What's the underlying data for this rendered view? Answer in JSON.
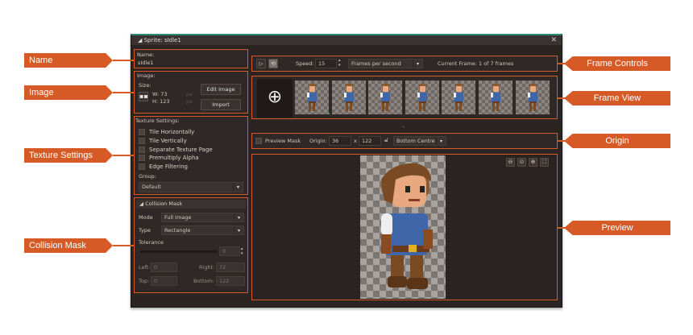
{
  "window": {
    "title": "Sprite: sIdle1"
  },
  "annotations": {
    "name": "Name",
    "image": "Image",
    "texture": "Texture Settings",
    "collision": "Collision Mask",
    "frame_controls": "Frame Controls",
    "frame_view": "Frame View",
    "origin": "Origin",
    "preview": "Preview"
  },
  "name_section": {
    "label": "Name:",
    "value": "sIdle1"
  },
  "image_section": {
    "label": "Image:",
    "size_label": "Size:",
    "width": "W: 73",
    "height": "H: 123",
    "unit": "px",
    "edit_button": "Edit Image",
    "import_button": "Import"
  },
  "texture": {
    "label": "Texture Settings:",
    "options": [
      "Tile Horizontally",
      "Tile Vertically",
      "Separate Texture Page",
      "Premultiply Alpha",
      "Edge Filtering"
    ],
    "group_label": "Group:",
    "group_value": "Default"
  },
  "collision": {
    "header": "Collision Mask",
    "mode_label": "Mode",
    "mode_value": "Full Image",
    "type_label": "Type",
    "type_value": "Rectangle",
    "tolerance_label": "Tolerance",
    "tolerance_value": "0",
    "left_label": "Left:",
    "left_value": "0",
    "right_label": "Right:",
    "right_value": "72",
    "top_label": "Top:",
    "top_value": "0",
    "bottom_label": "Bottom:",
    "bottom_value": "122"
  },
  "frame_controls": {
    "speed_label": "Speed:",
    "speed_value": "15",
    "speed_unit": "Frames per second",
    "current_frame": "Current Frame: 1 of 7 frames"
  },
  "frames": {
    "count": 7,
    "selected": 1
  },
  "origin": {
    "preview_mask": "Preview Mask",
    "origin_label": "Origin:",
    "x": "36",
    "x_sep": "x",
    "y": "122",
    "preset": "Bottom Centre"
  }
}
